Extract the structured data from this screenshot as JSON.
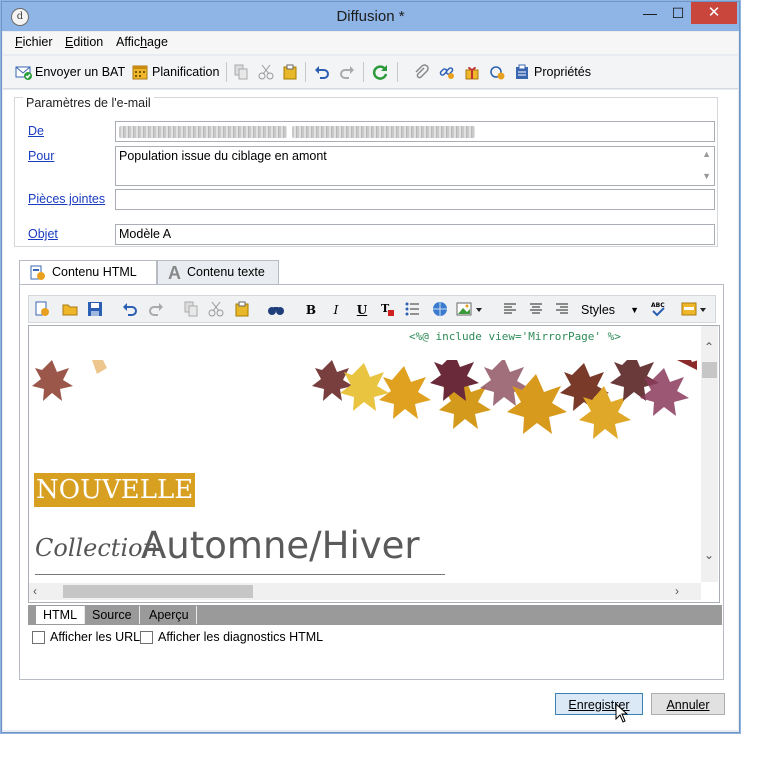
{
  "window": {
    "title": "Diffusion *"
  },
  "menu": {
    "items": [
      "Fichier",
      "Edition",
      "Affichage"
    ],
    "underline_chars": [
      "F",
      "E",
      "h"
    ]
  },
  "toolbar": {
    "send_bat": "Envoyer un BAT",
    "planning": "Planification",
    "properties": "Propriétés"
  },
  "email_params": {
    "group_title": "Paramètres de l'e-mail",
    "from_label": "De",
    "to_label": "Pour",
    "to_value": "Population issue du ciblage en amont",
    "attachments_label": "Pièces jointes",
    "subject_label": "Objet",
    "subject_value": "Modèle A"
  },
  "tabs": [
    {
      "label": "Contenu HTML",
      "icon": "html-content-icon",
      "active": true
    },
    {
      "label": "Contenu texte",
      "icon": "text-content-icon",
      "active": false
    }
  ],
  "editor_toolbar": {
    "styles_label": "Styles"
  },
  "editor": {
    "include_code": "<%@ include view='MirrorPage' %>",
    "badge": "NOUVELLE",
    "collection": "Collection",
    "season": "Automne/Hiver"
  },
  "bottom_tabs": [
    "HTML",
    "Source",
    "Aperçu"
  ],
  "checkboxes": [
    {
      "label": "Afficher les URL",
      "checked": false
    },
    {
      "label": "Afficher les diagnostics HTML",
      "checked": false
    }
  ],
  "buttons": {
    "save": "Enregistrer",
    "cancel": "Annuler"
  },
  "colors": {
    "badge": "#d7a021",
    "titlebar": "#8fb4e6",
    "link": "#1a3cbf"
  }
}
